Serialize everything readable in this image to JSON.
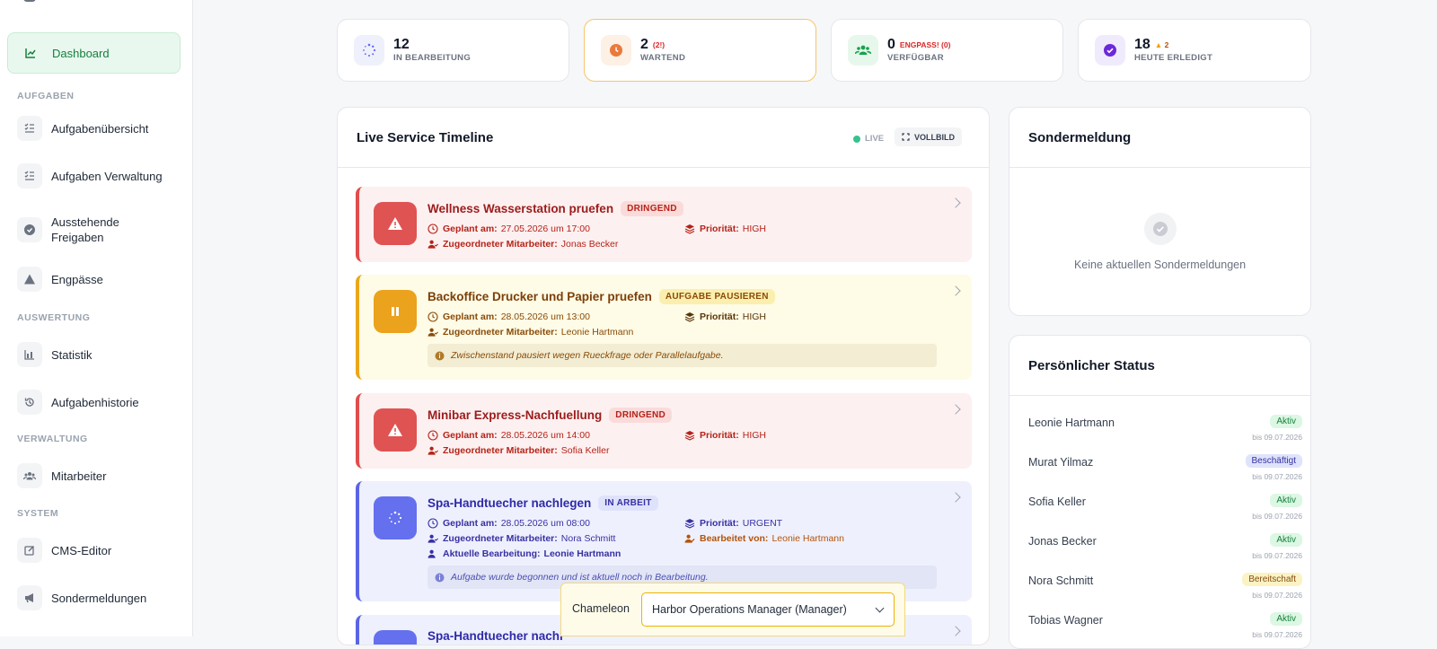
{
  "sidebar": {
    "active": "Dashboard",
    "sections": {
      "aufgaben": "AUFGABEN",
      "auswertung": "AUSWERTUNG",
      "verwaltung": "VERWALTUNG",
      "system": "SYSTEM"
    },
    "items": {
      "aufgabenuebersicht": "Aufgabenübersicht",
      "aufgaben_verwaltung": "Aufgaben Verwaltung",
      "ausstehende_1": "Ausstehende",
      "ausstehende_2": "Freigaben",
      "engpaesse": "Engpässe",
      "statistik": "Statistik",
      "aufgabenhistorie": "Aufgabenhistorie",
      "mitarbeiter": "Mitarbeiter",
      "cms": "CMS-Editor",
      "sondermeldungen": "Sondermeldungen"
    }
  },
  "stats": [
    {
      "num": "12",
      "label": "IN BEARBEITUNG",
      "badge": ""
    },
    {
      "num": "2",
      "label": "WARTEND",
      "badge": "(2!)"
    },
    {
      "num": "0",
      "label": "VERFÜGBAR",
      "badge": "ENGPASS! (0)"
    },
    {
      "num": "18",
      "label": "HEUTE ERLEDIGT",
      "badge": "2"
    }
  ],
  "timeline": {
    "title": "Live Service Timeline",
    "live": "LIVE",
    "fullscreen": "VOLLBILD",
    "labels": {
      "planned": "Geplant am:",
      "assigned": "Zugeordneter Mitarbeiter:",
      "priority": "Priorität:",
      "current": "Aktuelle Bearbeitung:",
      "edited_by": "Bearbeitet von:"
    },
    "tasks": [
      {
        "title": "Wellness Wasserstation pruefen",
        "tag": "DRINGEND",
        "planned": "27.05.2026 um 17:00",
        "assigned": "Jonas Becker",
        "priority": "HIGH"
      },
      {
        "title": "Backoffice Drucker und Papier pruefen",
        "tag": "AUFGABE PAUSIEREN",
        "planned": "28.05.2026 um 13:00",
        "assigned": "Leonie Hartmann",
        "priority": "HIGH",
        "note": "Zwischenstand pausiert wegen Rueckfrage oder Parallelaufgabe."
      },
      {
        "title": "Minibar Express-Nachfuellung",
        "tag": "DRINGEND",
        "planned": "28.05.2026 um 14:00",
        "assigned": "Sofia Keller",
        "priority": "HIGH"
      },
      {
        "title": "Spa-Handtuecher nachlegen",
        "tag": "IN ARBEIT",
        "planned": "28.05.2026 um 08:00",
        "assigned": "Nora Schmitt",
        "priority": "URGENT",
        "current": "Leonie Hartmann",
        "edited_by": "Leonie Hartmann",
        "note": "Aufgabe wurde begonnen und ist aktuell noch in Bearbeitung."
      },
      {
        "title": "Spa-Handtuecher nachl"
      }
    ]
  },
  "special": {
    "title": "Sondermeldung",
    "empty": "Keine aktuellen Sondermeldungen"
  },
  "personal": {
    "title": "Persönlicher Status",
    "rows": [
      {
        "name": "Leonie Hartmann",
        "status": "Aktiv",
        "until": "bis 09.07.2026"
      },
      {
        "name": "Murat Yilmaz",
        "status": "Beschäftigt",
        "until": "bis 09.07.2026"
      },
      {
        "name": "Sofia Keller",
        "status": "Aktiv",
        "until": "bis 09.07.2026"
      },
      {
        "name": "Jonas Becker",
        "status": "Aktiv",
        "until": "bis 09.07.2026"
      },
      {
        "name": "Nora Schmitt",
        "status": "Bereitschaft",
        "until": "bis 09.07.2026"
      },
      {
        "name": "Tobias Wagner",
        "status": "Aktiv",
        "until": "bis 09.07.2026"
      }
    ]
  },
  "chameleon": {
    "label": "Chameleon",
    "selected": "Harbor Operations Manager (Manager)"
  },
  "colors": {
    "green": "#16a34a",
    "red": "#ef4444",
    "amber": "#eab308",
    "indigo": "#6366f1",
    "purple": "#6d28d9"
  }
}
